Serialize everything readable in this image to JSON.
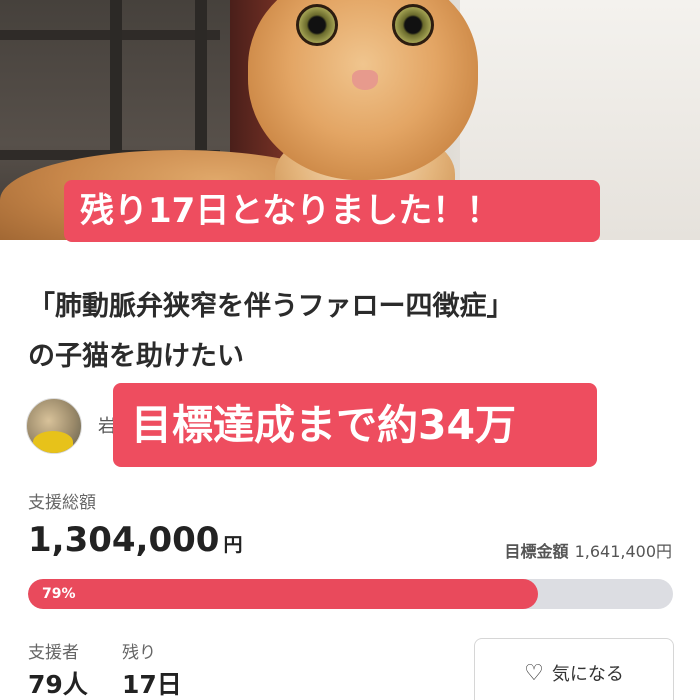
{
  "hero": {
    "banner_top": "残り17日となりました！！"
  },
  "project": {
    "title_line1": "「肺動脈弁狭窄を伴うファロー四徴症」",
    "title_line2": "の子猫を助けたい",
    "owner_name_partial": "岩",
    "banner_mid": "目標達成まで約34万"
  },
  "funding": {
    "total_label": "支援総額",
    "total_amount": "1,304,000",
    "currency": "円",
    "goal_label": "目標金額",
    "goal_amount": "1,641,400円",
    "progress_percent": 79,
    "progress_text": "79%",
    "supporters_label": "支援者",
    "supporters_value": "79人",
    "remaining_label": "残り",
    "remaining_value": "17日"
  },
  "actions": {
    "favorite_label": "気になる"
  },
  "colors": {
    "accent": "#ee4d5f",
    "progress_fill": "#e94a5c",
    "progress_track": "#dcdde2"
  },
  "icons": {
    "favorite": "heart-icon"
  }
}
